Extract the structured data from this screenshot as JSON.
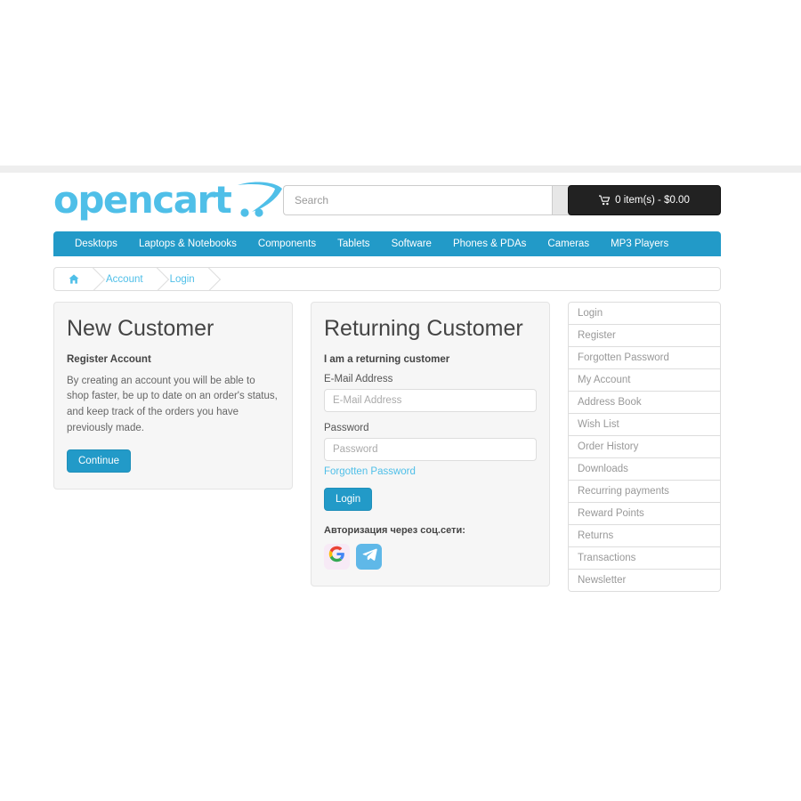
{
  "header": {
    "logo_text": "opencart",
    "logo_icon": "shopping-cart-swoosh",
    "search": {
      "placeholder": "Search",
      "value": "",
      "button_icon": "search-icon"
    },
    "cart": {
      "icon": "cart-icon",
      "label": "0 item(s) - $0.00"
    }
  },
  "nav": {
    "items": [
      {
        "label": "Desktops"
      },
      {
        "label": "Laptops & Notebooks"
      },
      {
        "label": "Components"
      },
      {
        "label": "Tablets"
      },
      {
        "label": "Software"
      },
      {
        "label": "Phones & PDAs"
      },
      {
        "label": "Cameras"
      },
      {
        "label": "MP3 Players"
      }
    ]
  },
  "breadcrumb": {
    "home_icon": "home-icon",
    "items": [
      {
        "label": "Account"
      },
      {
        "label": "Login"
      }
    ]
  },
  "new_customer": {
    "heading": "New Customer",
    "subheading": "Register Account",
    "description": "By creating an account you will be able to shop faster, be up to date on an order's status, and keep track of the orders you have previously made.",
    "continue_label": "Continue"
  },
  "returning_customer": {
    "heading": "Returning Customer",
    "subheading": "I am a returning customer",
    "email_label": "E-Mail Address",
    "email_placeholder": "E-Mail Address",
    "email_value": "",
    "password_label": "Password",
    "password_placeholder": "Password",
    "password_value": "",
    "forgotten_label": "Forgotten Password",
    "login_label": "Login",
    "social_label": "Авторизация через соц.сети:",
    "social": [
      {
        "name": "google",
        "icon": "google-icon"
      },
      {
        "name": "telegram",
        "icon": "telegram-icon"
      }
    ]
  },
  "sidebar": {
    "items": [
      {
        "label": "Login"
      },
      {
        "label": "Register"
      },
      {
        "label": "Forgotten Password"
      },
      {
        "label": "My Account"
      },
      {
        "label": "Address Book"
      },
      {
        "label": "Wish List"
      },
      {
        "label": "Order History"
      },
      {
        "label": "Downloads"
      },
      {
        "label": "Recurring payments"
      },
      {
        "label": "Reward Points"
      },
      {
        "label": "Returns"
      },
      {
        "label": "Transactions"
      },
      {
        "label": "Newsletter"
      }
    ]
  },
  "colors": {
    "brand_blue": "#229ac8",
    "logo_blue": "#4fbfe8",
    "link_blue": "#4fbfe8",
    "cart_dark": "#222222",
    "panel_bg": "#f6f6f6"
  }
}
